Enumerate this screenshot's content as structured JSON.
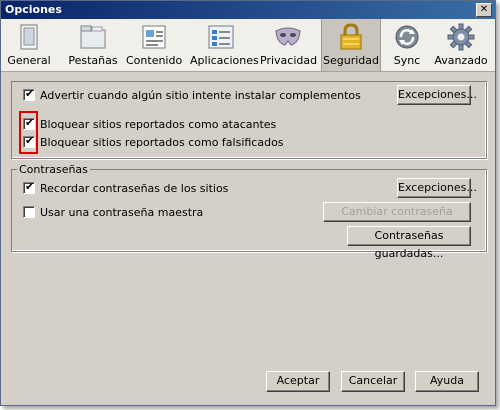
{
  "window": {
    "title": "Opciones",
    "close_glyph": "✕"
  },
  "tabs": [
    {
      "label": "General",
      "icon": "general-icon"
    },
    {
      "label": "Pestañas",
      "icon": "tabs-icon"
    },
    {
      "label": "Contenido",
      "icon": "content-icon"
    },
    {
      "label": "Aplicaciones",
      "icon": "applications-icon"
    },
    {
      "label": "Privacidad",
      "icon": "privacy-mask-icon"
    },
    {
      "label": "Seguridad",
      "icon": "security-lock-icon",
      "selected": true
    },
    {
      "label": "Sync",
      "icon": "sync-icon"
    },
    {
      "label": "Avanzado",
      "icon": "gear-icon"
    }
  ],
  "security": {
    "warn_addons_label": "Advertir cuando algún sitio intente instalar complementos",
    "warn_addons_checked": true,
    "exceptions_label": "Excepciones...",
    "block_attack_label": "Bloquear sitios reportados como atacantes",
    "block_attack_checked": true,
    "block_forgery_label": "Bloquear sitios reportados como falsificados",
    "block_forgery_checked": true
  },
  "passwords": {
    "legend": "Contraseñas",
    "remember_label": "Recordar contraseñas de los sitios",
    "remember_checked": true,
    "exceptions_label": "Excepciones...",
    "master_label": "Usar una contraseña maestra",
    "master_checked": false,
    "change_master_label": "Cambiar contraseña maestra...",
    "saved_label": "Contraseñas guardadas..."
  },
  "footer": {
    "ok_label": "Aceptar",
    "cancel_label": "Cancelar",
    "help_label": "Ayuda"
  },
  "colors": {
    "highlight": "#e00000",
    "titlebar": "#0a246a"
  },
  "check_glyph": "✔"
}
